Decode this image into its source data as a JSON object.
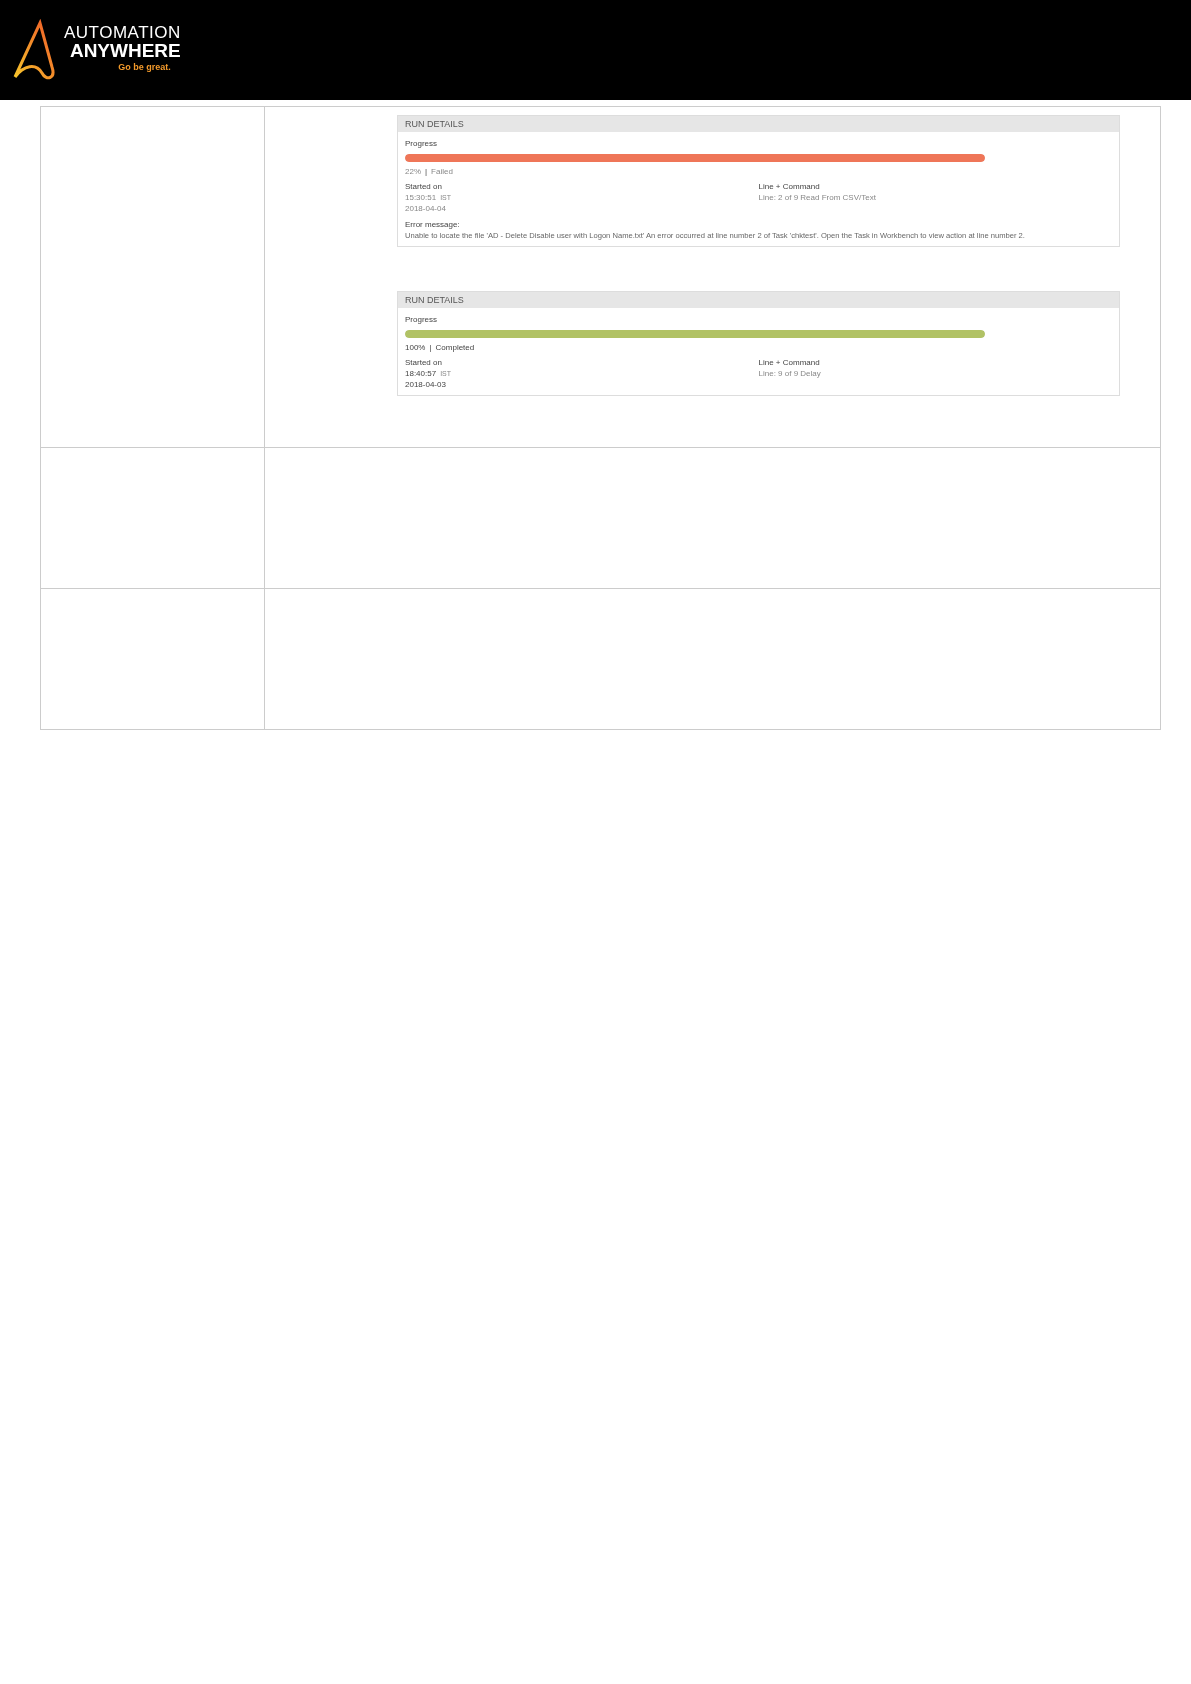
{
  "header": {
    "logo": {
      "line_1": "AUTOMATION",
      "line_2": "ANYWHERE",
      "tagline": "Go be great."
    }
  },
  "table": {
    "rows": [
      {
        "run_details": [
          {
            "title": "RUN DETAILS",
            "progress_label": "Progress",
            "kind": "failed",
            "level": 1,
            "percent": "22%",
            "separator": "|",
            "status": "Failed",
            "started_label": "Started on",
            "time": "15:30:51",
            "timezone": "IST",
            "date": "2018-04-04",
            "command_label": "Line + Command",
            "command": "Line: 2 of 9 Read From CSV/Text",
            "error_label": "Error message:",
            "error": "Unable to locate the file 'AD - Delete Disable user with Logon Name.txt' An error occurred at line number 2 of Task 'chktest'. Open the Task in Workbench to view action at line number 2."
          },
          {
            "title": "RUN DETAILS",
            "progress_label": "Progress",
            "kind": "completed",
            "level": 1,
            "percent": "100%",
            "separator": "|",
            "status": "Completed",
            "started_label": "Started on",
            "time": "18:40:57",
            "timezone": "IST",
            "date": "2018-04-03",
            "command_label": "Line + Command",
            "command": "Line: 9 of 9 Delay"
          }
        ]
      },
      {
        "run_details": []
      },
      {
        "run_details": []
      }
    ]
  }
}
